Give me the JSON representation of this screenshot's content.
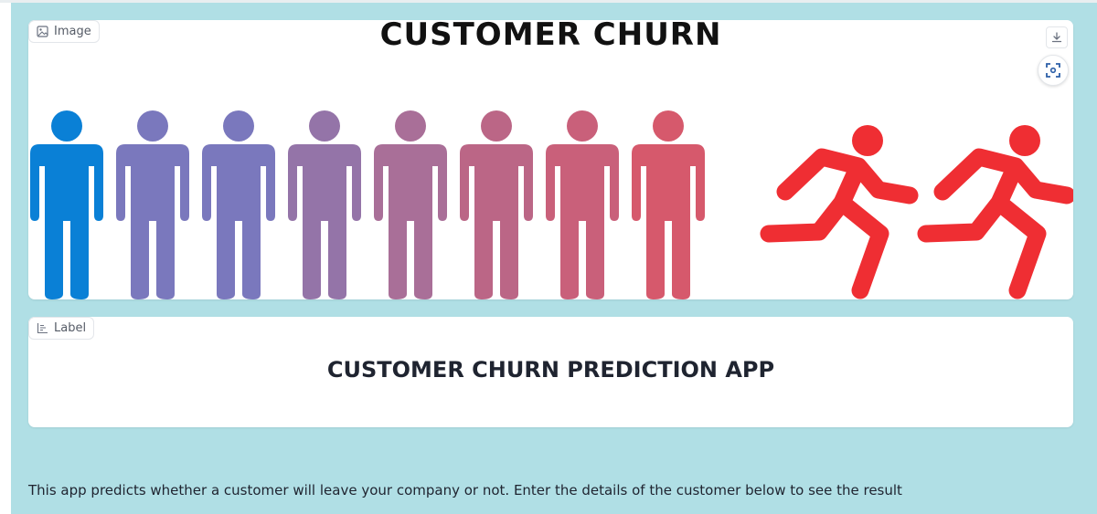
{
  "image_block": {
    "chip_label": "Image",
    "banner_title": "CUSTOMER CHURN",
    "download_icon": "download-icon",
    "fullscreen_icon": "focus-frame-icon",
    "person_colors": [
      "#0a80d6",
      "#7a78bd",
      "#7a78bd",
      "#9474a8",
      "#a96f98",
      "#bb6686",
      "#c9607a",
      "#d6596c"
    ],
    "runner_color": "#ef2e33"
  },
  "label_block": {
    "chip_label": "Label",
    "chip_icon": "bar-chart-icon",
    "text": "CUSTOMER CHURN PREDICTION APP"
  },
  "description": "This app predicts whether a customer will leave your company or not. Enter the details of the customer below to see the result"
}
